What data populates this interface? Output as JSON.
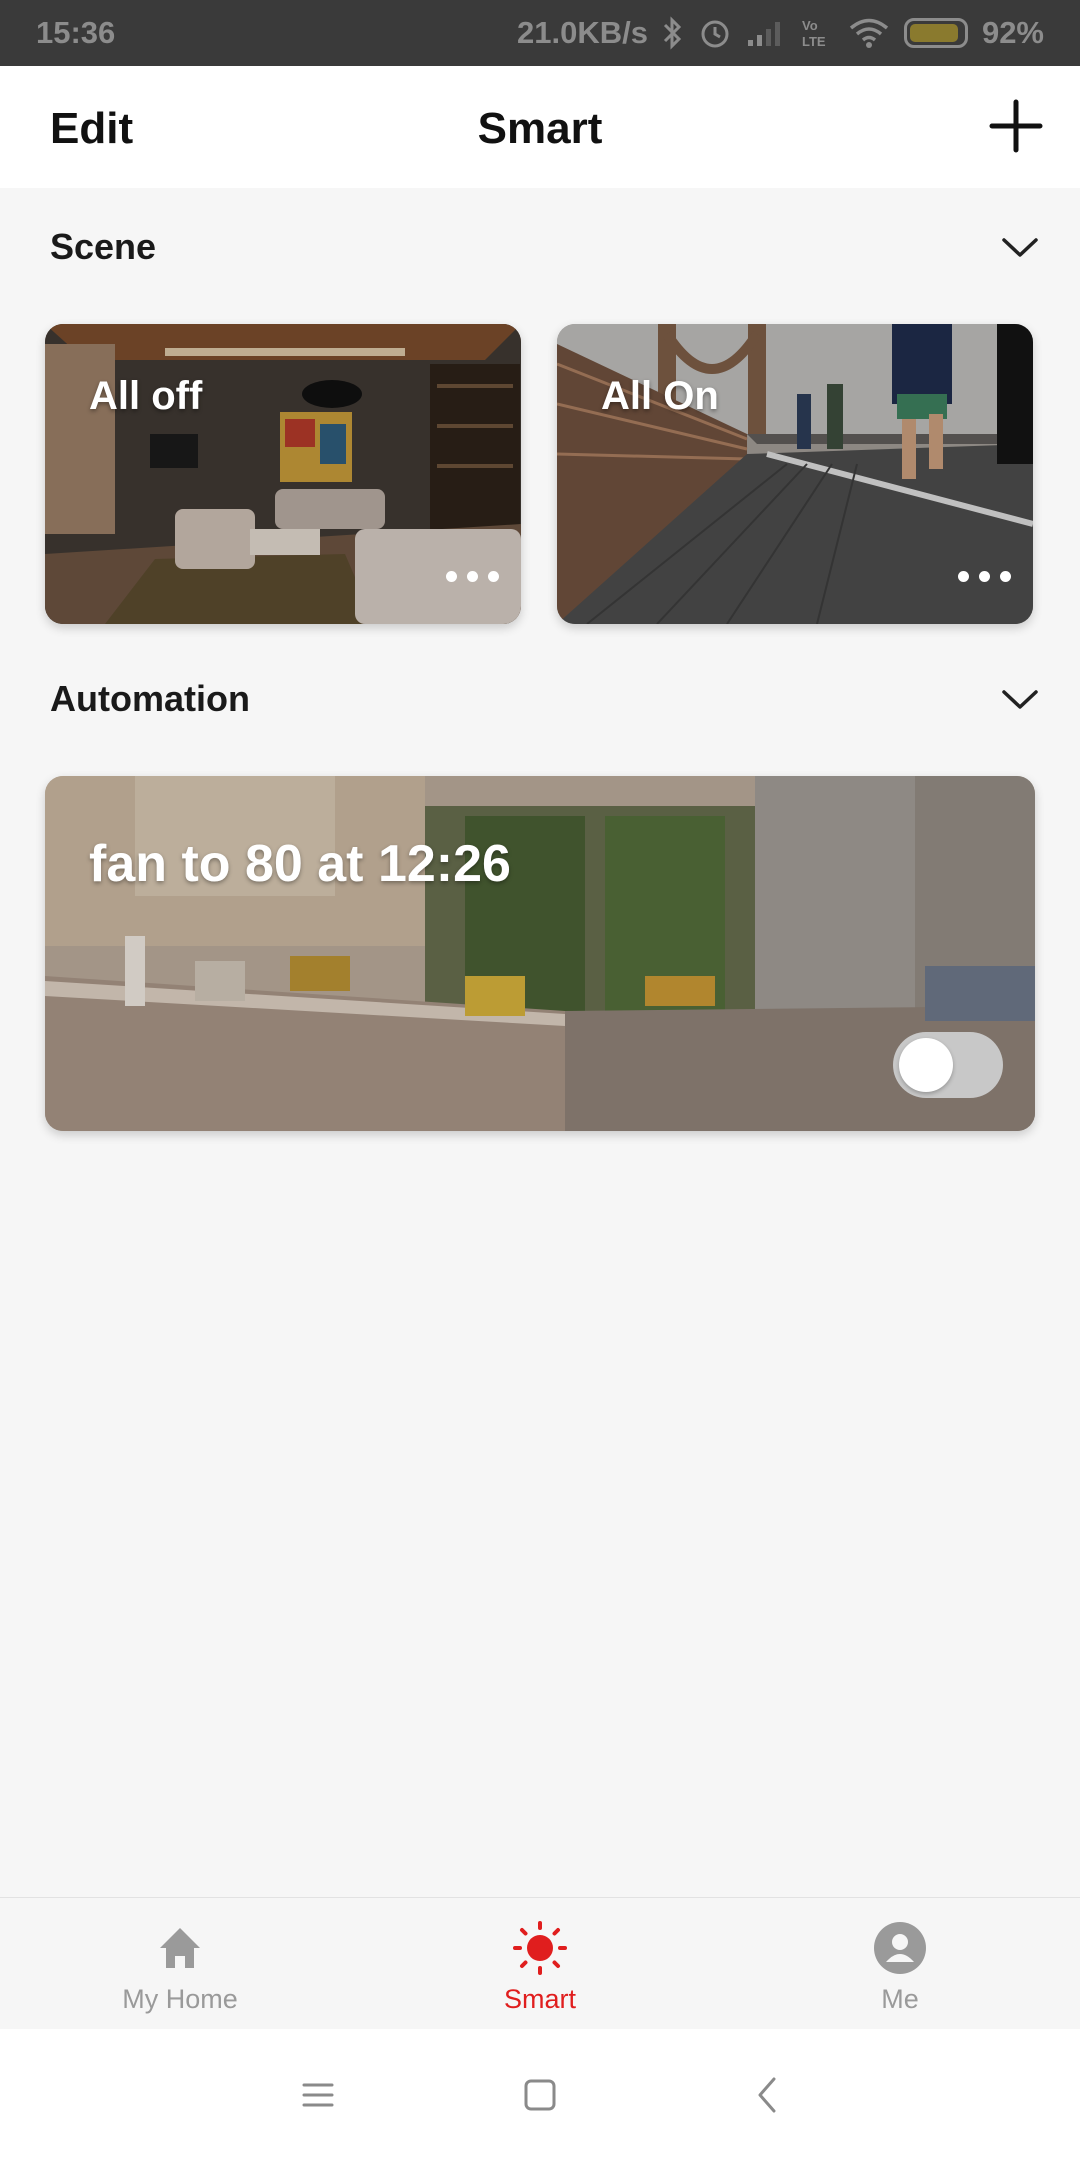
{
  "status_bar": {
    "time": "15:36",
    "net_speed": "21.0KB/s",
    "battery_percent": "92%",
    "battery_level": 0.92,
    "icons": [
      "bluetooth-icon",
      "alarm-icon",
      "signal-icon",
      "volte-icon",
      "wifi-icon",
      "battery-icon"
    ]
  },
  "header": {
    "edit_label": "Edit",
    "title": "Smart",
    "add_icon": "plus-icon"
  },
  "scene": {
    "title": "Scene",
    "cards": [
      {
        "title": "All off"
      },
      {
        "title": "All On"
      }
    ]
  },
  "automation": {
    "title": "Automation",
    "items": [
      {
        "title": "fan to 80 at 12:26",
        "enabled": false
      }
    ]
  },
  "bottom_nav": {
    "items": [
      {
        "label": "My Home",
        "icon": "home-icon"
      },
      {
        "label": "Smart",
        "icon": "sun-icon",
        "active": true
      },
      {
        "label": "Me",
        "icon": "person-icon"
      }
    ]
  },
  "colors": {
    "accent": "#e01e1e",
    "inactive": "#9a9a9a"
  }
}
